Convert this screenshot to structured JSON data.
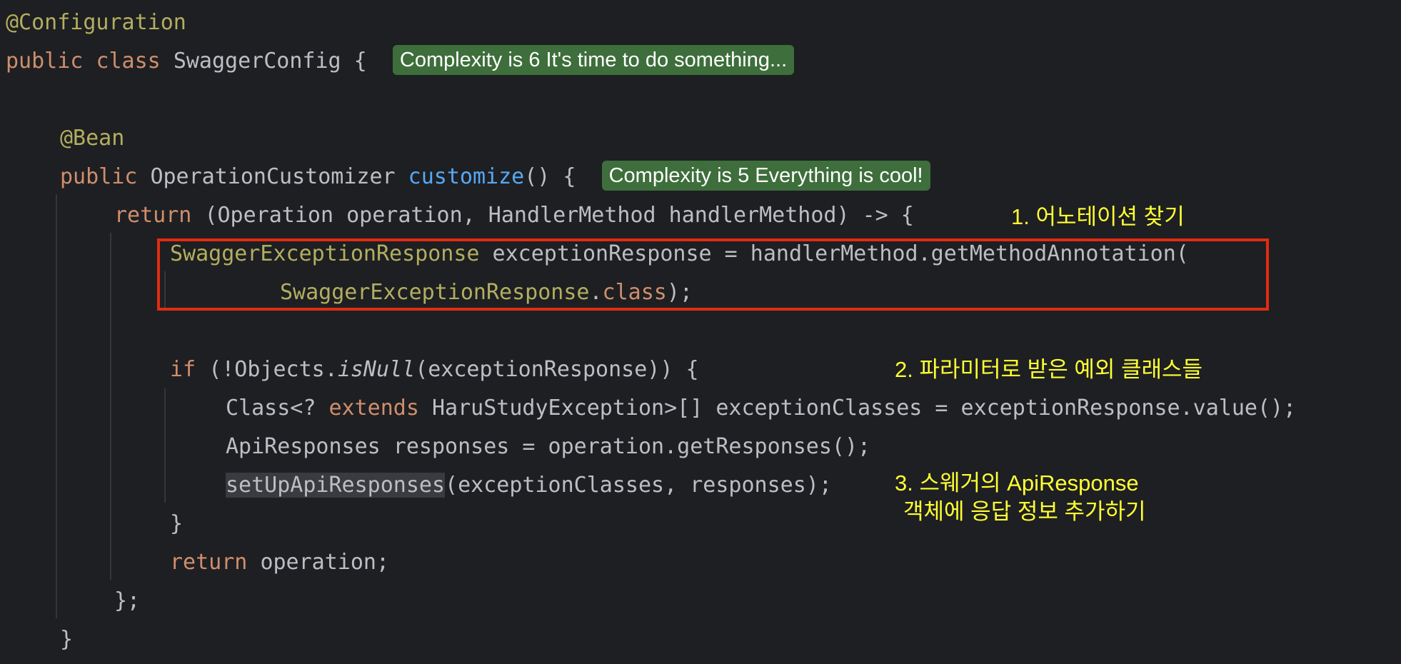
{
  "code": {
    "l1_annotation": "@Configuration",
    "l2_kw_public": "public",
    "l2_kw_class": "class",
    "l2_name": "SwaggerConfig {",
    "l2_hint": "Complexity is 6 It's time to do something...",
    "l4_annotation": "@Bean",
    "l5_kw_public": "public",
    "l5_type": "OperationCustomizer",
    "l5_method": "customize",
    "l5_rest": "() {",
    "l5_hint": "Complexity is 5 Everything is cool!",
    "l6_kw_return": "return",
    "l6_rest": "(Operation operation, HandlerMethod handlerMethod) -> {",
    "l7_type": "SwaggerExceptionResponse",
    "l7_rest": "exceptionResponse = handlerMethod.getMethodAnnotation(",
    "l8_type": "SwaggerExceptionResponse",
    "l8_dot": ".",
    "l8_kw_class": "class",
    "l8_end": ");",
    "l10_kw_if": "if",
    "l10_a": "(!Objects.",
    "l10_isnull": "isNull",
    "l10_b": "(exceptionResponse)) {",
    "l11_a": "Class<? ",
    "l11_kw_extends": "extends",
    "l11_b": "HaruStudyException>[] exceptionClasses = exceptionResponse.value();",
    "l12": "ApiResponses responses = operation.getResponses();",
    "l13_call": "setUpApiResponses",
    "l13_rest": "(exceptionClasses, responses);",
    "l14": "}",
    "l15_kw_return": "return",
    "l15_rest": "operation;",
    "l16": "};",
    "l17": "}"
  },
  "notes": {
    "note1": "1. 어노테이션 찾기",
    "note2": "2. 파라미터로 받은 예외 클래스들",
    "note3_line1": "3. 스웨거의 ApiResponse",
    "note3_line2": "객체에 응답 정보 추가하기"
  },
  "colors": {
    "background": "#1e1f22",
    "text": "#bcbec4",
    "keyword": "#cf8e6d",
    "annotation": "#b3ae60",
    "method": "#56a8f5",
    "hint_background": "#3d6e3b",
    "highlight_box": "#e12c12",
    "note_text": "#ffff33"
  }
}
